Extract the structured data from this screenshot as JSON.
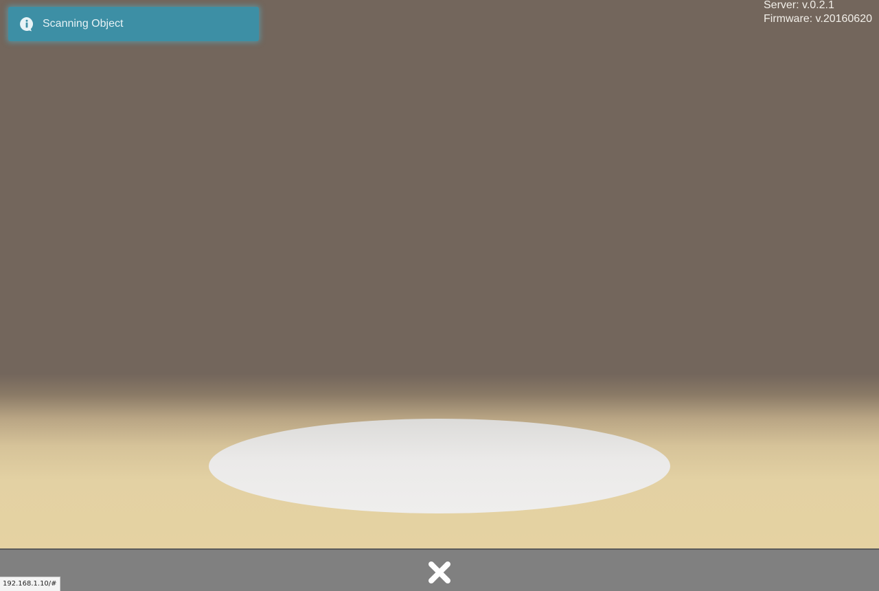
{
  "notification": {
    "icon": "info-icon",
    "message": "Scanning Object",
    "color": "#3d8fa5"
  },
  "version": {
    "server": "Server: v.0.2.1",
    "firmware": "Firmware: v.20160620"
  },
  "toolbar": {
    "close_icon": "close-icon"
  },
  "status_bar": {
    "url": "192.168.1.10/#"
  }
}
